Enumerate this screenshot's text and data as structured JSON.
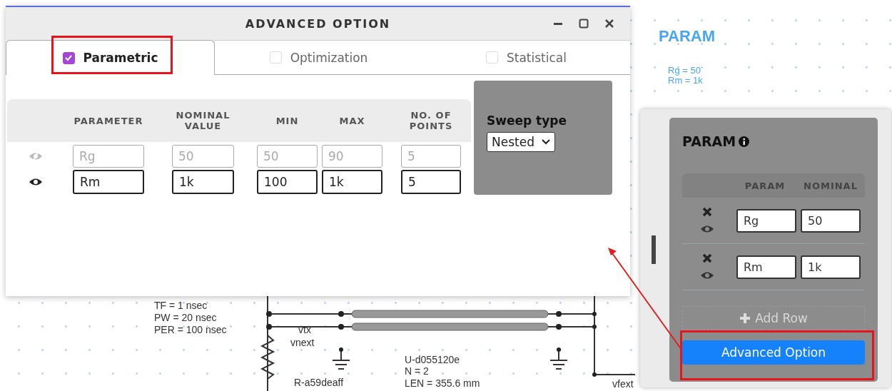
{
  "canvas": {
    "title": "PARAM",
    "params": [
      "Rg = 50",
      "Rm = 1k"
    ],
    "labels": [
      {
        "text": "TF = 1 nsec"
      },
      {
        "text": "PW = 20 nsec"
      },
      {
        "text": "PER = 100 nsec"
      },
      {
        "text": "vtx"
      },
      {
        "text": "vnext"
      },
      {
        "text": "U-d055120e"
      },
      {
        "text": "N = 2"
      },
      {
        "text": "R-a59deaff"
      },
      {
        "text": "LEN = 355.6 mm"
      },
      {
        "text": "vfext"
      }
    ]
  },
  "dialog": {
    "title": "ADVANCED OPTION",
    "tabs": [
      {
        "label": "Parametric",
        "checked": true,
        "selected": true
      },
      {
        "label": "Optimization",
        "checked": false,
        "selected": false
      },
      {
        "label": "Statistical",
        "checked": false,
        "selected": false
      }
    ],
    "columns": [
      "PARAMETER",
      "NOMINAL VALUE",
      "MIN",
      "MAX",
      "NO. OF POINTS"
    ],
    "rows": [
      {
        "visible": false,
        "values": [
          "Rg",
          "50",
          "50",
          "90",
          "5"
        ]
      },
      {
        "visible": true,
        "values": [
          "Rm",
          "1k",
          "100",
          "1k",
          "5"
        ]
      }
    ],
    "sweep": {
      "label": "Sweep type",
      "value": "Nested"
    }
  },
  "panel": {
    "title": "PARAM",
    "columns": [
      "PARAM",
      "NOMINAL"
    ],
    "rows": [
      {
        "visible": true,
        "name": "Rg",
        "nominal": "50"
      },
      {
        "visible": true,
        "name": "Rm",
        "nominal": "1k"
      }
    ],
    "add_row": "Add Row",
    "button": "Advanced Option"
  }
}
